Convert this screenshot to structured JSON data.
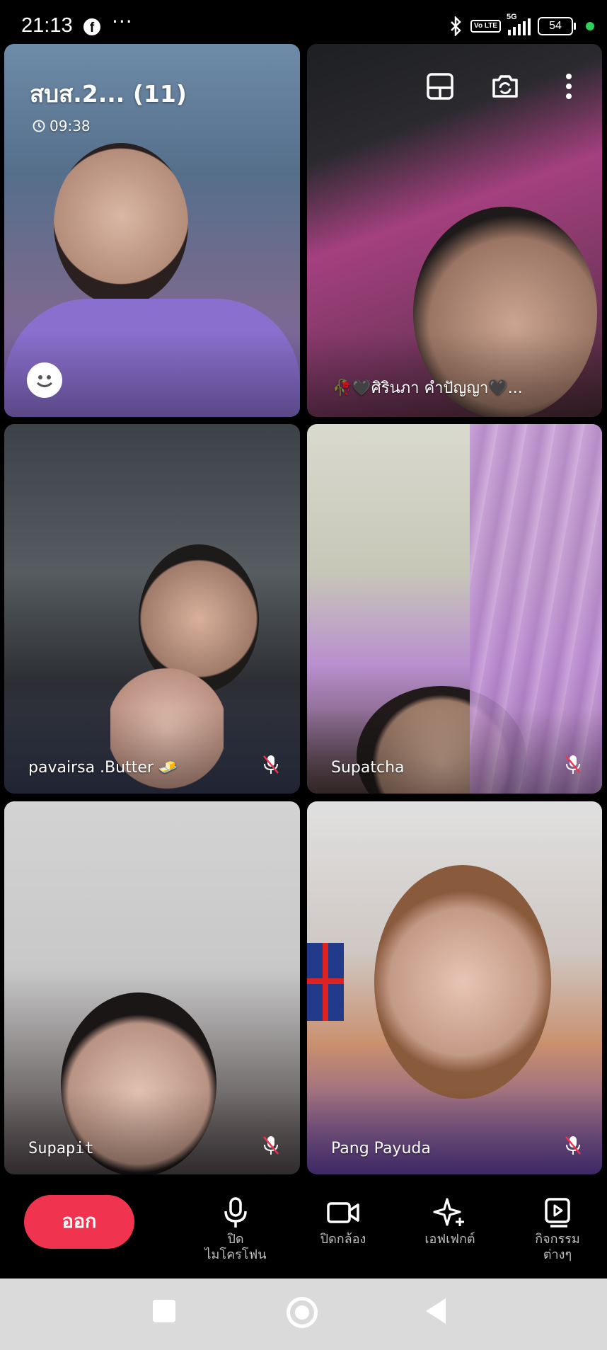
{
  "status_bar": {
    "time": "21:13",
    "more": "···",
    "network": "5G",
    "volte": "Vo LTE",
    "battery": "54",
    "icons": [
      "facebook-icon",
      "bluetooth-icon",
      "signal-icon",
      "battery-icon",
      "active-dot"
    ]
  },
  "call": {
    "title": "สบส.2... (11)",
    "timer": "09:38"
  },
  "participants": [
    {
      "name": ""
    },
    {
      "name": "🥀🖤ศิรินภา คำปัญญา🖤..."
    },
    {
      "name": "pavairsa .Butter 🧈",
      "muted": true
    },
    {
      "name": "Supatcha",
      "muted": true
    },
    {
      "name": "Supapit",
      "muted": true
    },
    {
      "name": "Pang Payuda",
      "muted": true
    }
  ],
  "controls": {
    "leave": "ออก",
    "mic": [
      "ปิด",
      "ไมโครโฟน"
    ],
    "camera": "ปิดกล้อง",
    "effects": "เอฟเฟกต์",
    "activities": [
      "กิจกรรม",
      "ต่างๆ"
    ]
  },
  "colors": {
    "leave": "#f0344f",
    "accent_dot": "#2ed158"
  }
}
